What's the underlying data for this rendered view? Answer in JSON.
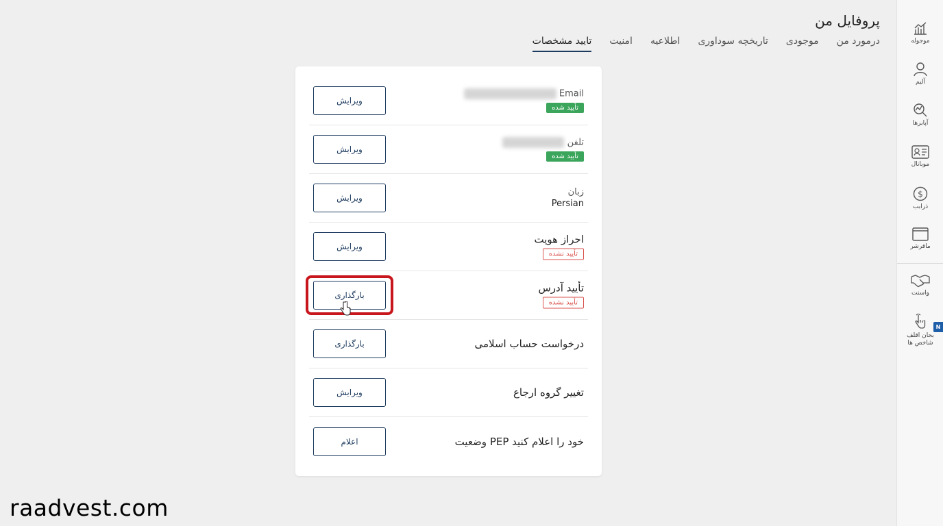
{
  "header": {
    "title": "پروفایل من",
    "tabs": [
      {
        "label": "درمورد من",
        "active": false
      },
      {
        "label": "موجودی",
        "active": false
      },
      {
        "label": "تاریخچه سوداوری",
        "active": false
      },
      {
        "label": "اطلاعیه",
        "active": false
      },
      {
        "label": "امنیت",
        "active": false
      },
      {
        "label": "تایید مشخصات",
        "active": true
      }
    ]
  },
  "sidebar": {
    "items": [
      {
        "label": "موجوله",
        "icon": "chart-icon"
      },
      {
        "label": "آلیم",
        "icon": "user-icon"
      },
      {
        "label": "آپابرها",
        "icon": "analytics-icon"
      },
      {
        "label": "موبانال",
        "icon": "id-card-icon"
      },
      {
        "label": "ذرابب",
        "icon": "dollar-icon"
      },
      {
        "label": "ماقرشر",
        "icon": "window-icon"
      },
      {
        "label": "واسنت",
        "icon": "handshake-icon"
      },
      {
        "label": "بحان اقلف شاخص ها",
        "icon": "hand-pointer-icon"
      }
    ],
    "new_badge": "N"
  },
  "rows": [
    {
      "title": "Email",
      "badge": "تأیید شده",
      "badge_type": "ok",
      "button": "ویرایش"
    },
    {
      "title": "تلفن",
      "badge": "تأیید شده",
      "badge_type": "ok",
      "button": "ویرایش"
    },
    {
      "title": "زبان",
      "value": "Persian",
      "button": "ویرایش"
    },
    {
      "title": "احراز هویت",
      "badge": "تأیید نشده",
      "badge_type": "no",
      "button": "ویرایش"
    },
    {
      "title": "تأیید آدرس",
      "badge": "تأیید نشده",
      "badge_type": "no",
      "button": "بارگذاری"
    },
    {
      "title": "درخواست حساب اسلامی",
      "button": "بارگذاری"
    },
    {
      "title": "تغییر گروه ارجاع",
      "button": "ویرایش"
    },
    {
      "title": "وضعیت PEP خود را اعلام کنید",
      "button": "اعلام"
    }
  ],
  "watermark": "raadvest.com",
  "colors": {
    "primary": "#1d3b5e",
    "verified": "#3aa55b",
    "unverified": "#d9534f",
    "highlight": "#c8161d"
  }
}
